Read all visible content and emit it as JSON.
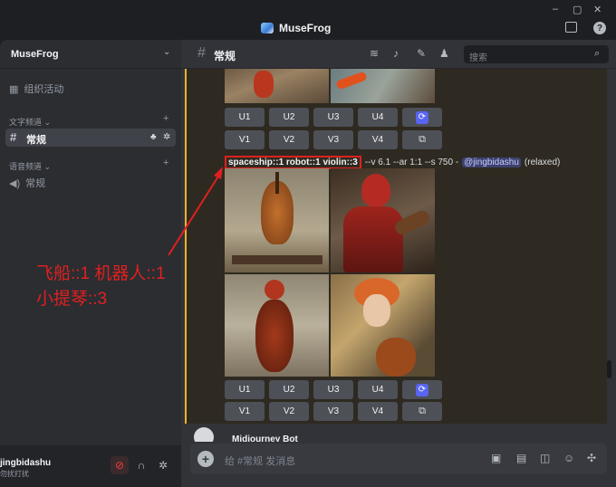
{
  "app": {
    "title": "MuseFrog"
  },
  "window": {
    "controls": [
      "–",
      "▢",
      "✕"
    ]
  },
  "sidebar": {
    "server_name": "MuseFrog",
    "events_label": "组织活动",
    "text_category": "文字频道",
    "text_channel": "常规",
    "voice_category": "语音频道",
    "voice_channel": "常规"
  },
  "user_panel": {
    "name": "jingbidashu",
    "status": "勿扰打扰"
  },
  "header": {
    "channel": "常规",
    "search_placeholder": "搜索"
  },
  "message": {
    "upscale_buttons": [
      "U1",
      "U2",
      "U3",
      "U4"
    ],
    "variation_buttons": [
      "V1",
      "V2",
      "V3",
      "V4"
    ],
    "prompt_highlight": "spaceship::1 robot::1 violin::3",
    "prompt_params": "--v 6.1 --ar 1:1 --s 750 -",
    "mention": "@jingbidashu",
    "mode": "(relaxed)"
  },
  "next_message_user": "Midjourney Bot",
  "composer": {
    "placeholder": "给 #常规 发消息"
  },
  "annotation": {
    "line1": "飞船::1 机器人::1",
    "line2": "小提琴::3"
  },
  "colors": {
    "accent_red": "#e02020",
    "blurple": "#5865f2",
    "highlight_bar": "#f0b232"
  },
  "icons": [
    "calendar-icon",
    "hash-icon",
    "speaker-icon",
    "threads-icon",
    "bell-icon",
    "pin-icon",
    "members-icon",
    "search-icon",
    "refresh-icon",
    "external-link-icon",
    "mic-off-icon",
    "headphones-icon",
    "gear-icon",
    "gift-icon",
    "gif-icon",
    "sticker-icon",
    "emoji-icon",
    "apps-icon",
    "inbox-icon",
    "help-icon"
  ]
}
